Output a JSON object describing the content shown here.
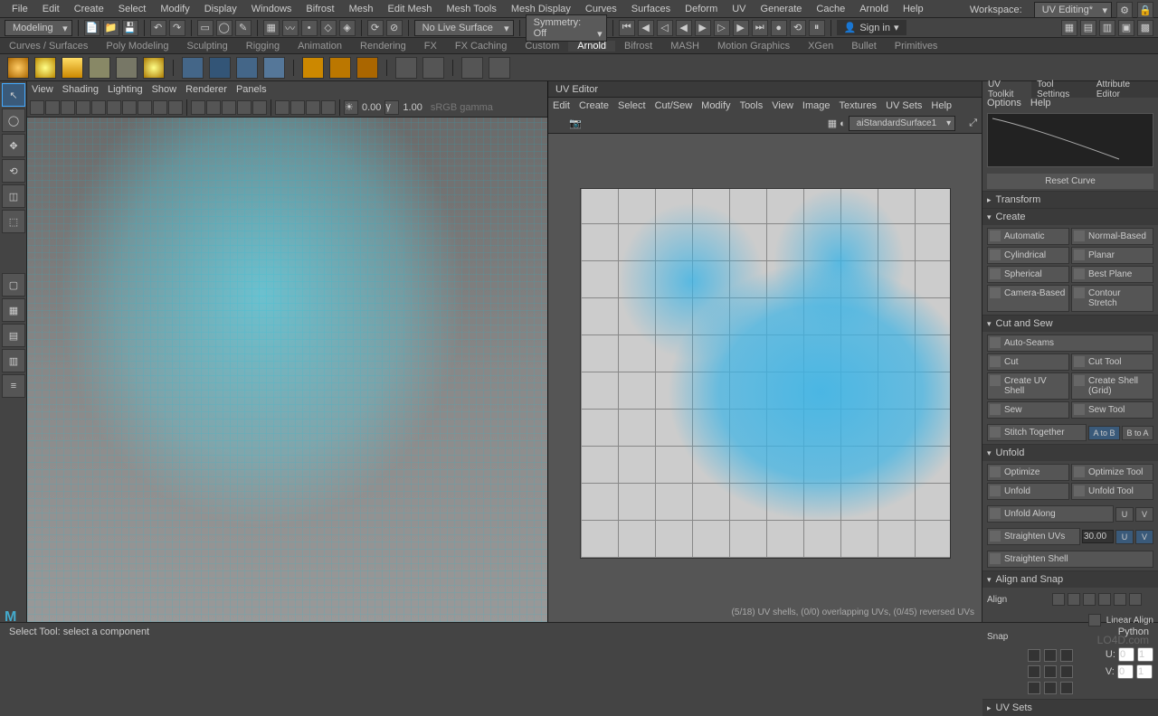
{
  "menubar": [
    "File",
    "Edit",
    "Create",
    "Select",
    "Modify",
    "Display",
    "Windows",
    "Bifrost",
    "Mesh",
    "Edit Mesh",
    "Mesh Tools",
    "Mesh Display",
    "Curves",
    "Surfaces",
    "Deform",
    "UV",
    "Generate",
    "Cache",
    "Arnold",
    "Help"
  ],
  "workspace": {
    "label": "Workspace:",
    "value": "UV Editing*"
  },
  "mode_dropdown": "Modeling",
  "live_surface": "No Live Surface",
  "symmetry": "Symmetry: Off",
  "signin": "Sign in",
  "shelf_tabs": [
    "Curves / Surfaces",
    "Poly Modeling",
    "Sculpting",
    "Rigging",
    "Animation",
    "Rendering",
    "FX",
    "FX Caching",
    "Custom",
    "Arnold",
    "Bifrost",
    "MASH",
    "Motion Graphics",
    "XGen",
    "Bullet",
    "Primitives"
  ],
  "shelf_active": "Arnold",
  "viewport": {
    "menus": [
      "View",
      "Shading",
      "Lighting",
      "Show",
      "Renderer",
      "Panels"
    ],
    "exposure": "0.00",
    "gamma": "1.00",
    "colorspace": "sRGB gamma"
  },
  "uveditor": {
    "title": "UV Editor",
    "menus": [
      "Edit",
      "Create",
      "Select",
      "Cut/Sew",
      "Modify",
      "Tools",
      "View",
      "Image",
      "Textures",
      "UV Sets",
      "Help"
    ],
    "material": "aiStandardSurface1",
    "status": "(5/18) UV shells, (0/0) overlapping UVs, (0/45) reversed UVs"
  },
  "rightpanel": {
    "tabs": [
      "UV Toolkit",
      "Tool Settings",
      "Attribute Editor"
    ],
    "menus": [
      "Options",
      "Help"
    ],
    "reset": "Reset Curve",
    "sections": {
      "transform": "Transform",
      "create": "Create",
      "cutsew": "Cut and Sew",
      "unfold": "Unfold",
      "alignsnap": "Align and Snap",
      "uvsets": "UV Sets"
    },
    "create_buttons": [
      "Automatic",
      "Normal-Based",
      "Cylindrical",
      "Planar",
      "Spherical",
      "Best Plane",
      "Camera-Based",
      "Contour Stretch"
    ],
    "autoseams": "Auto-Seams",
    "cutsew_buttons": [
      [
        "Cut",
        "Cut Tool"
      ],
      [
        "Create UV Shell",
        "Create Shell (Grid)"
      ],
      [
        "Sew",
        "Sew Tool"
      ]
    ],
    "stitch": {
      "label": "Stitch Together",
      "a": "A to B",
      "b": "B to A"
    },
    "unfold_buttons": [
      [
        "Optimize",
        "Optimize Tool"
      ],
      [
        "Unfold",
        "Unfold Tool"
      ]
    ],
    "unfold_along": {
      "label": "Unfold Along",
      "u": "U",
      "v": "V"
    },
    "straighten": {
      "label": "Straighten UVs",
      "value": "30.00",
      "u": "U",
      "v": "V"
    },
    "straighten_shell": "Straighten Shell",
    "align_label": "Align",
    "linear_align": "Linear Align",
    "snap_label": "Snap",
    "uv_coords": {
      "u_label": "U:",
      "u0": "0",
      "u1": "1",
      "v_label": "V:",
      "v0": "0",
      "v1": "1"
    }
  },
  "statusbar": {
    "left": "Select Tool: select a component",
    "right": "Python"
  },
  "watermark": "LO4D.com"
}
